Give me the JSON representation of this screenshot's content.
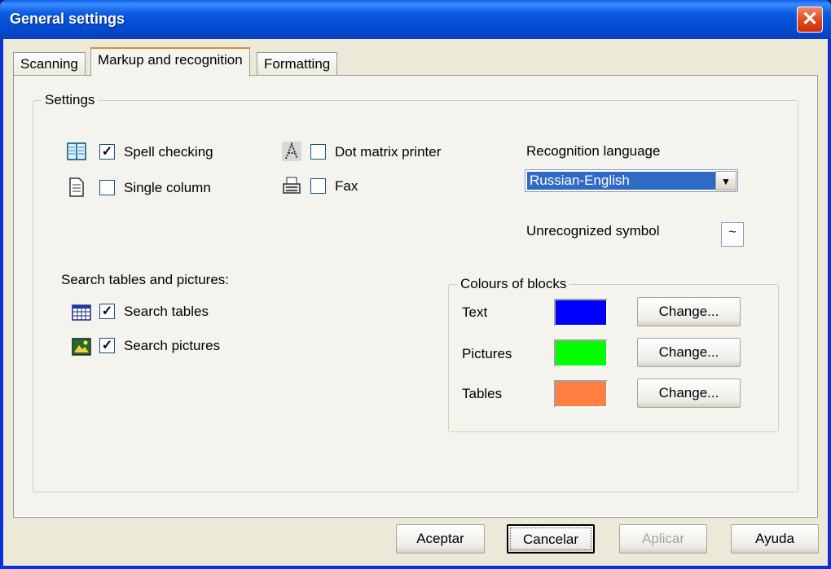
{
  "window": {
    "title": "General settings"
  },
  "tabs": [
    {
      "label": "Scanning"
    },
    {
      "label": "Markup and recognition"
    },
    {
      "label": "Formatting"
    }
  ],
  "settings_group": {
    "label": "Settings",
    "spell_checking": {
      "label": "Spell checking",
      "checked": true,
      "icon": "book-icon"
    },
    "single_column": {
      "label": "Single column",
      "checked": false,
      "icon": "document-icon"
    },
    "dot_matrix_printer": {
      "label": "Dot matrix printer",
      "checked": false,
      "icon": "dotted-letter-icon"
    },
    "fax": {
      "label": "Fax",
      "checked": false,
      "icon": "fax-icon"
    },
    "recognition_language": {
      "label": "Recognition language",
      "value": "Russian-English"
    },
    "unrecognized_symbol": {
      "label": "Unrecognized symbol",
      "value": "~"
    },
    "search_section": {
      "label": "Search tables and pictures:",
      "search_tables": {
        "label": "Search tables",
        "checked": true,
        "icon": "table-icon"
      },
      "search_pictures": {
        "label": "Search pictures",
        "checked": true,
        "icon": "picture-icon"
      }
    }
  },
  "colours_group": {
    "label": "Colours of blocks",
    "rows": [
      {
        "label": "Text",
        "color": "#0000ff",
        "button": "Change..."
      },
      {
        "label": "Pictures",
        "color": "#00ff00",
        "button": "Change..."
      },
      {
        "label": "Tables",
        "color": "#ff8040",
        "button": "Change..."
      }
    ]
  },
  "footer": {
    "accept": "Aceptar",
    "cancel": "Cancelar",
    "apply": "Aplicar",
    "help": "Ayuda"
  },
  "check_mark": "✓",
  "close_glyph": "✕",
  "dropdown_glyph": "▼"
}
